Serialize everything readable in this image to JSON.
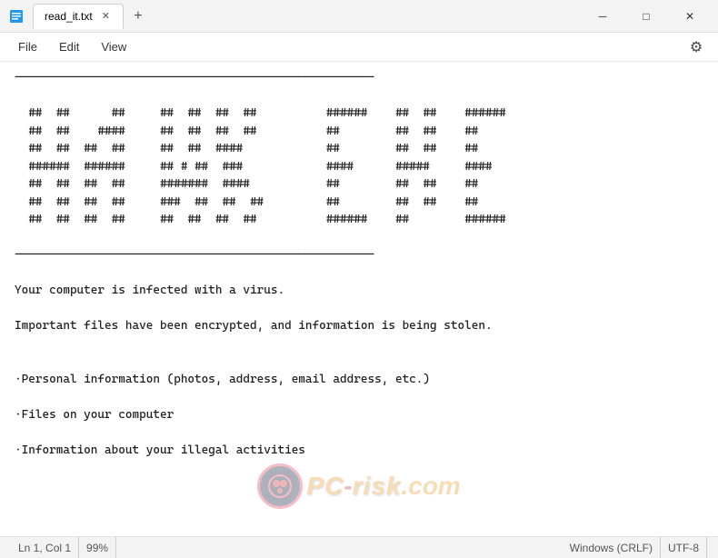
{
  "titlebar": {
    "tab_label": "read_it.txt",
    "new_tab_label": "+",
    "minimize_label": "─",
    "maximize_label": "□",
    "close_label": "✕"
  },
  "menubar": {
    "file_label": "File",
    "edit_label": "Edit",
    "view_label": "View"
  },
  "editor": {
    "content_lines": [
      "----------------------------------------------------",
      "",
      "  ##  ##      ##     ##  ##  ##  ##          ######    ##  ##    ######",
      "  ##  ##    ####     ##  ##  ##  ##          ##        ##  ##    ##",
      "  ##  ##  ##  ##     ##  ##  ####            ##        ##  ##    ##",
      "  ######  ######     ## # ##  ###            ####      #####     ####",
      "  ##  ##  ##  ##     #######  ####           ##        ##  ##    ##",
      "  ##  ##  ##  ##     ###  ##  ##  ##         ##        ##  ##    ##",
      "  ##  ##  ##  ##     ##  ##  ##  ##          ######    ##        ######",
      "",
      "----------------------------------------------------",
      "",
      "Your computer is infected with a virus.",
      "",
      "Important files have been encrypted, and information is being stolen.",
      "",
      "",
      "·Personal information (photos, address, email address, etc.)",
      "",
      "·Files on your computer",
      "",
      "·Information about your illegal activities"
    ]
  },
  "statusbar": {
    "position": "Ln 1, Col 1",
    "zoom": "99%",
    "line_ending": "Windows (CRLF)",
    "encoding": "UTF-8"
  }
}
